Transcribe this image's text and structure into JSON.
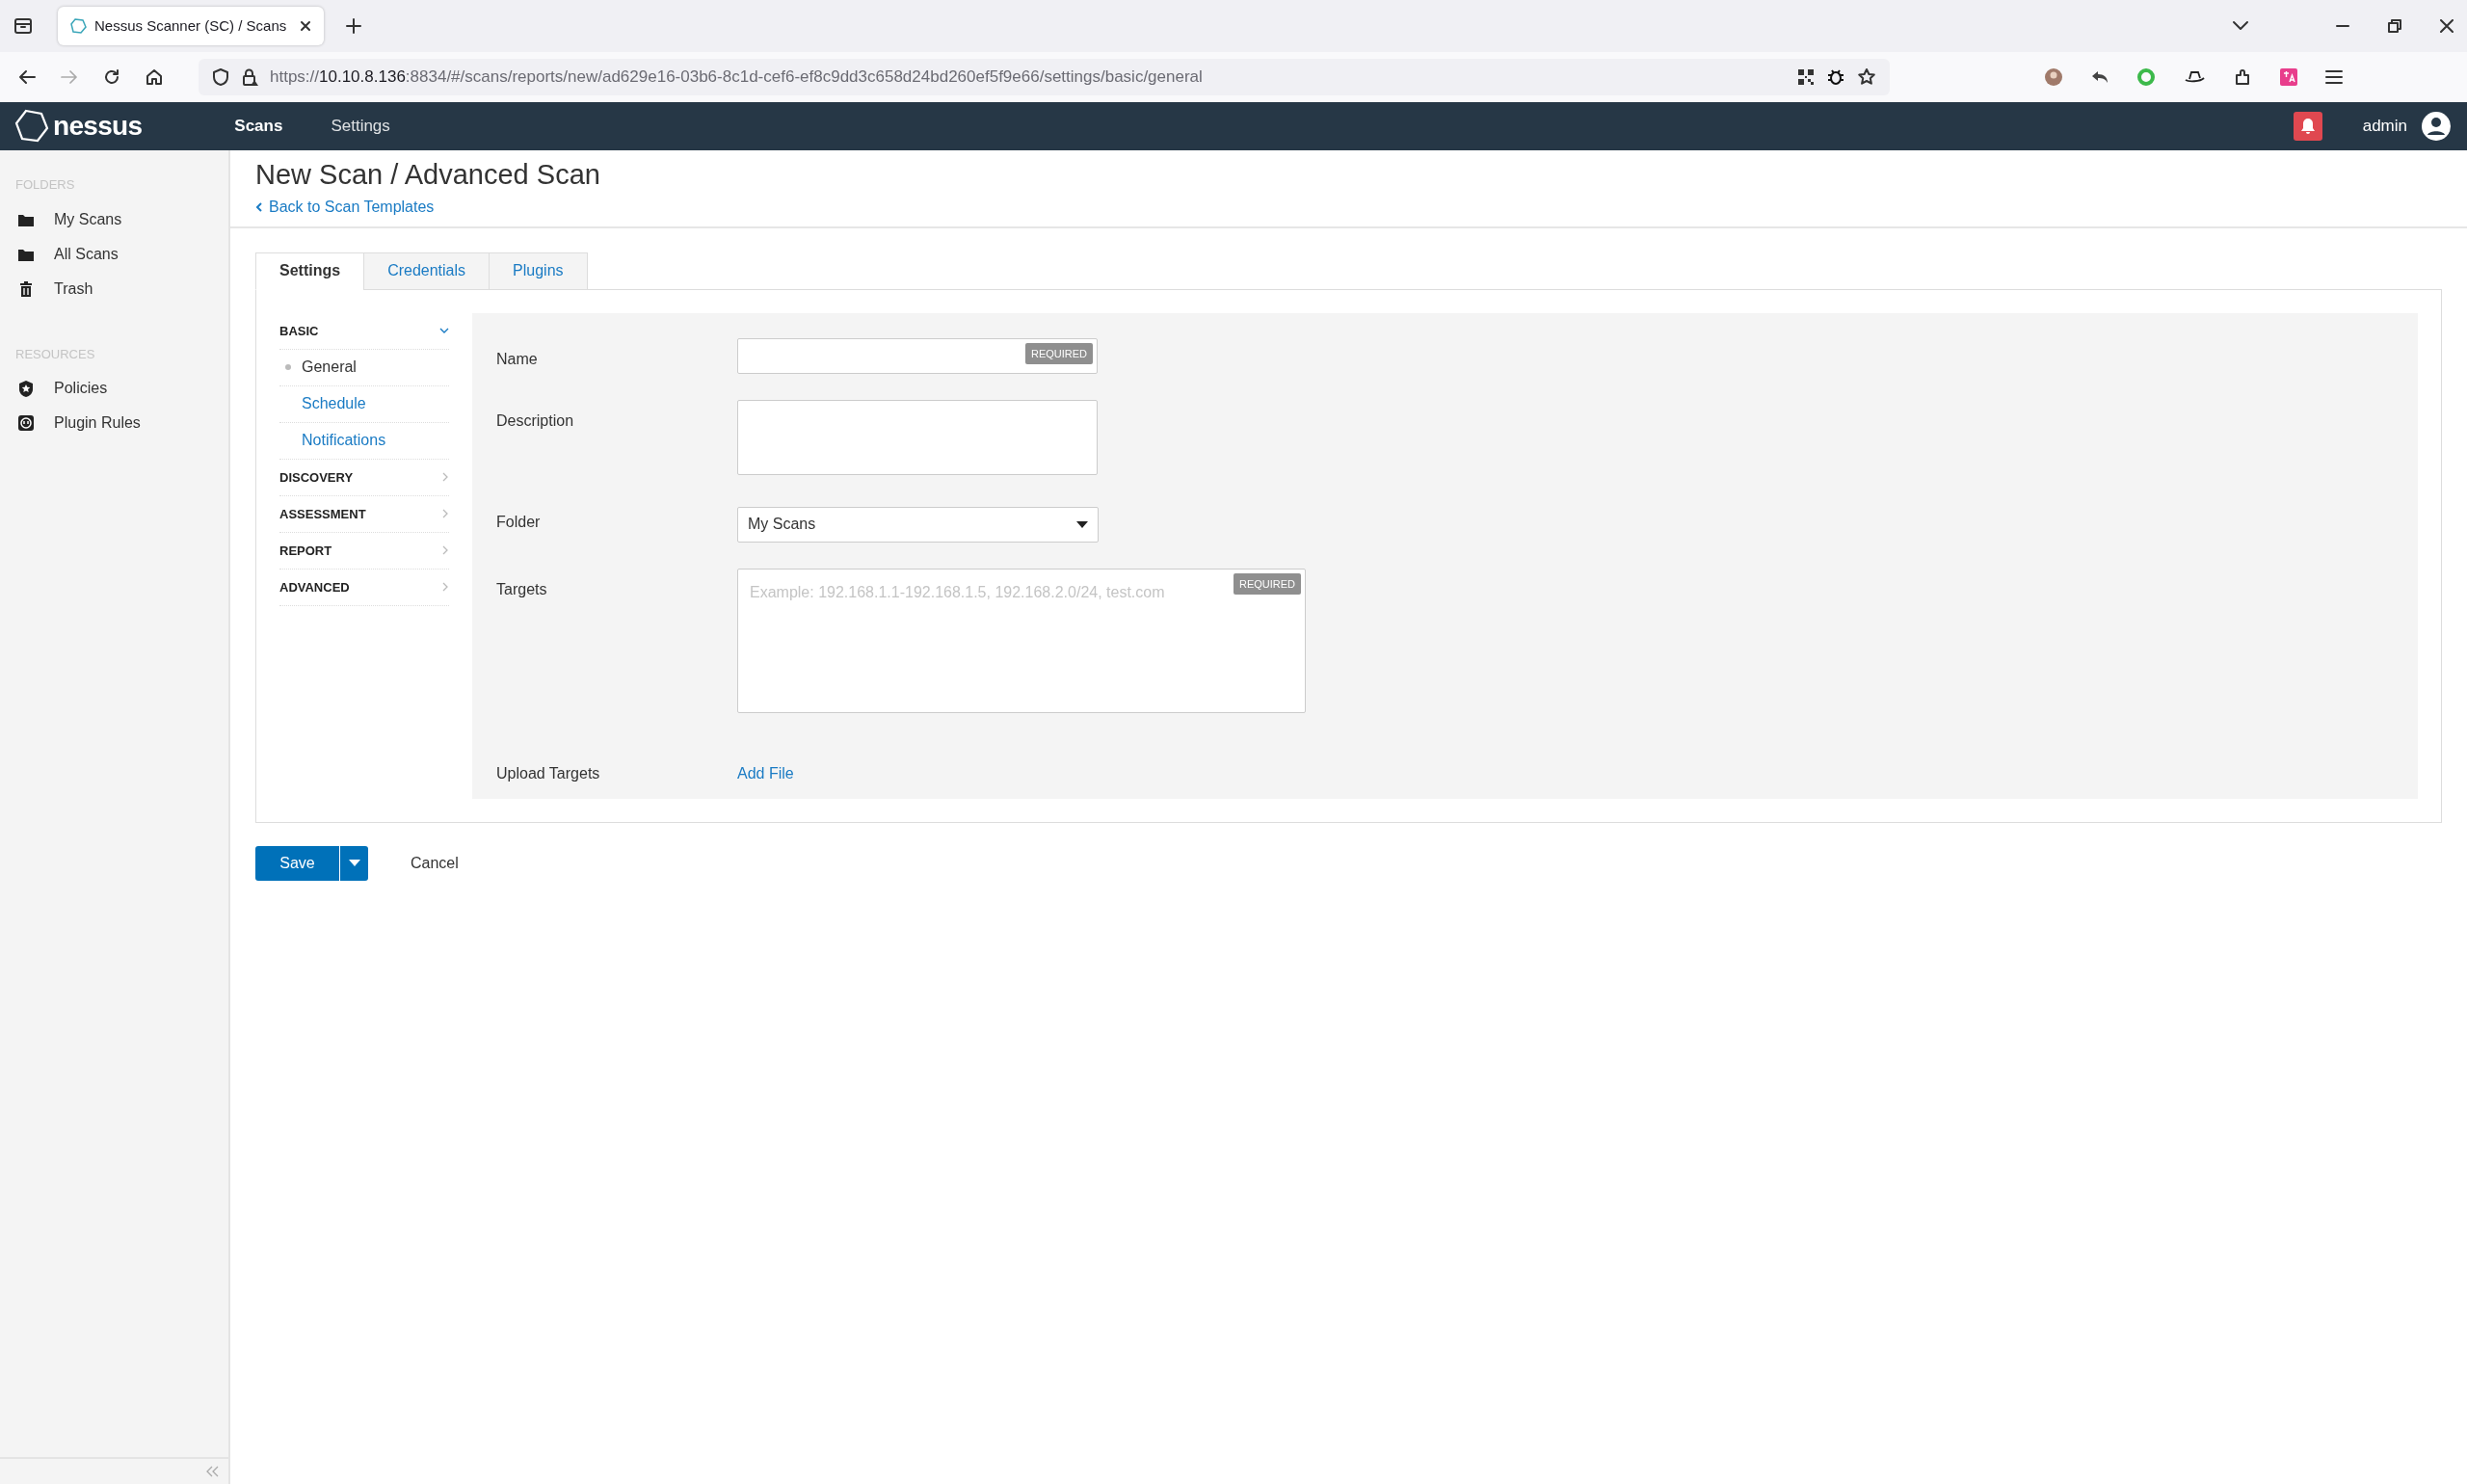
{
  "browser": {
    "tabs": [
      {
        "title": "Nessus Scanner (SC) / Scans",
        "selected": true
      }
    ],
    "address": {
      "scheme": "https://",
      "host": "10.10.8.136",
      "path": ":8834/#/scans/reports/new/ad629e16-03b6-8c1d-cef6-ef8c9dd3c658d24bd260ef5f9e66/settings/basic/general"
    }
  },
  "app_header": {
    "logo": "nessus",
    "nav": [
      {
        "label": "Scans",
        "selected": true
      },
      {
        "label": "Settings",
        "selected": false
      }
    ],
    "user": "admin"
  },
  "sidebar": {
    "sections": [
      {
        "heading": "FOLDERS",
        "items": [
          {
            "label": "My Scans",
            "kind": "folder"
          },
          {
            "label": "All Scans",
            "kind": "folder"
          },
          {
            "label": "Trash",
            "kind": "trash"
          }
        ]
      },
      {
        "heading": "RESOURCES",
        "items": [
          {
            "label": "Policies",
            "kind": "shield"
          },
          {
            "label": "Plugin Rules",
            "kind": "plug"
          }
        ]
      }
    ]
  },
  "page": {
    "title": "New Scan / Advanced Scan",
    "back_link": "Back to Scan Templates"
  },
  "tabs": [
    {
      "label": "Settings",
      "selected": true
    },
    {
      "label": "Credentials",
      "selected": false
    },
    {
      "label": "Plugins",
      "selected": false
    }
  ],
  "settings_nav": [
    {
      "label": "BASIC",
      "expanded": true,
      "children": [
        {
          "label": "General",
          "selected": true
        },
        {
          "label": "Schedule",
          "selected": false
        },
        {
          "label": "Notifications",
          "selected": false
        }
      ]
    },
    {
      "label": "DISCOVERY",
      "expanded": false
    },
    {
      "label": "ASSESSMENT",
      "expanded": false
    },
    {
      "label": "REPORT",
      "expanded": false
    },
    {
      "label": "ADVANCED",
      "expanded": false
    }
  ],
  "form": [
    {
      "kind": "text",
      "label": "Name",
      "badge": "REQUIRED"
    },
    {
      "kind": "textarea",
      "label": "Description"
    },
    {
      "kind": "select",
      "label": "Folder",
      "value": "My Scans"
    },
    {
      "kind": "wide_textarea",
      "label": "Targets",
      "placeholder": "Example: 192.168.1.1-192.168.1.5, 192.168.2.0/24, test.com",
      "badge": "REQUIRED"
    },
    {
      "kind": "link",
      "label": "Upload Targets",
      "link": "Add File"
    }
  ],
  "actions": {
    "save": "Save",
    "cancel": "Cancel"
  }
}
